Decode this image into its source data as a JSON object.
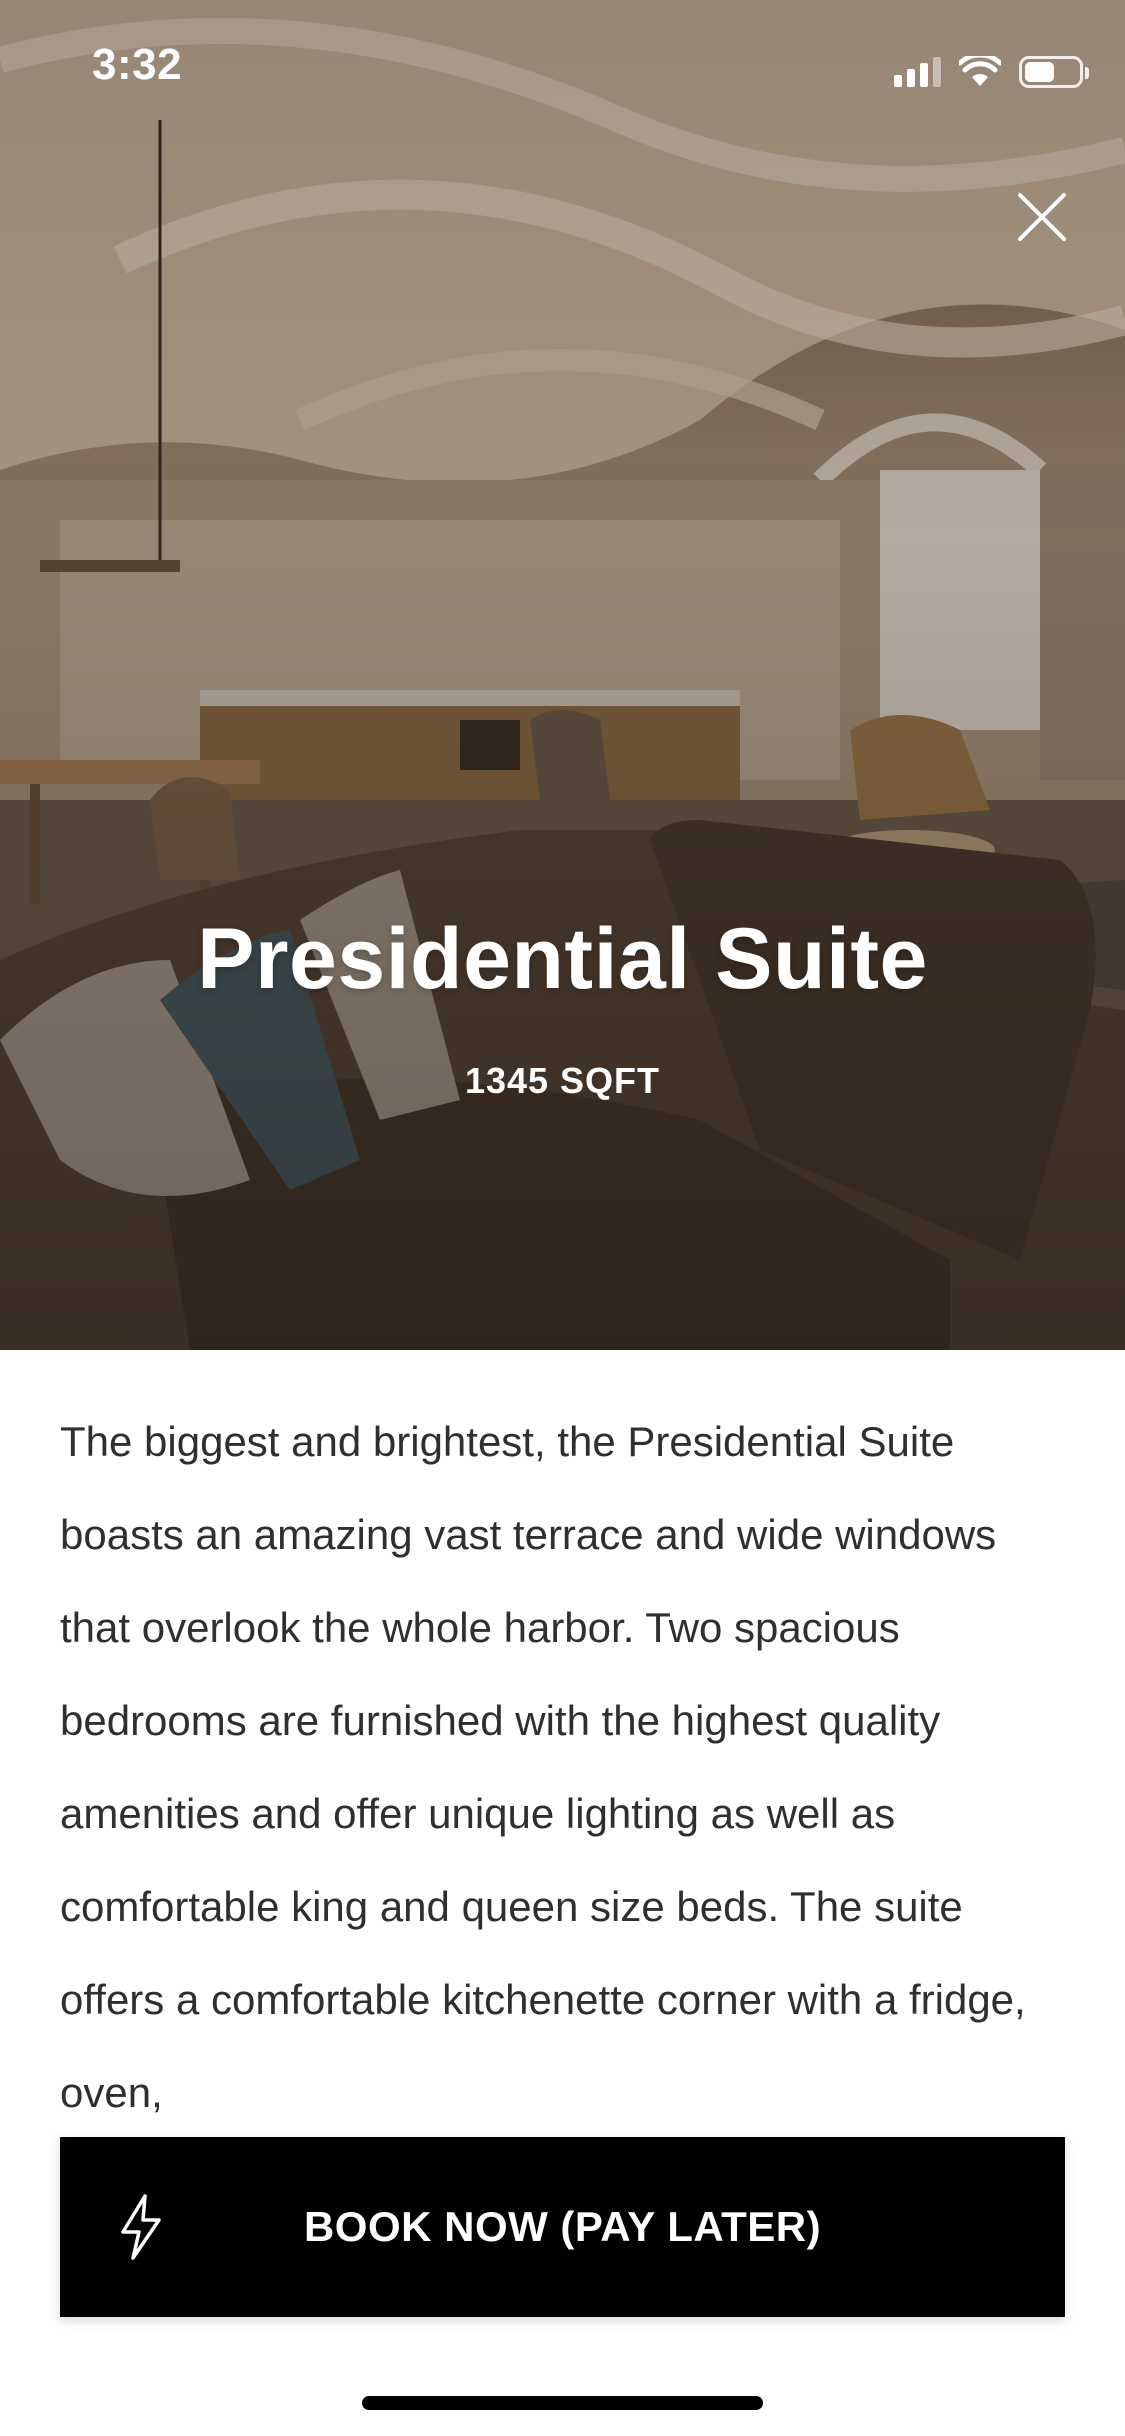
{
  "status_bar": {
    "time": "3:32",
    "icons": [
      "signal-icon",
      "wifi-icon",
      "battery-icon"
    ],
    "battery_level": 0.55
  },
  "hero": {
    "image_description_icon": "suite-photo",
    "title": "Presidential Suite",
    "subtitle": "1345 SQFT",
    "close_icon": "close-icon"
  },
  "description": {
    "text": "The biggest and brightest, the Presidential Suite boasts an amazing vast terrace and wide windows that overlook the whole harbor. Two spacious bedrooms are furnished with the highest quality amenities and offer unique lighting as well as comfortable king and queen size beds. The suite offers a comfortable kitchenette corner with a fridge, oven,"
  },
  "cta": {
    "label": "BOOK NOW (PAY LATER)",
    "icon": "lightning-bolt-icon",
    "background": "#000000",
    "text_color": "#ffffff"
  }
}
